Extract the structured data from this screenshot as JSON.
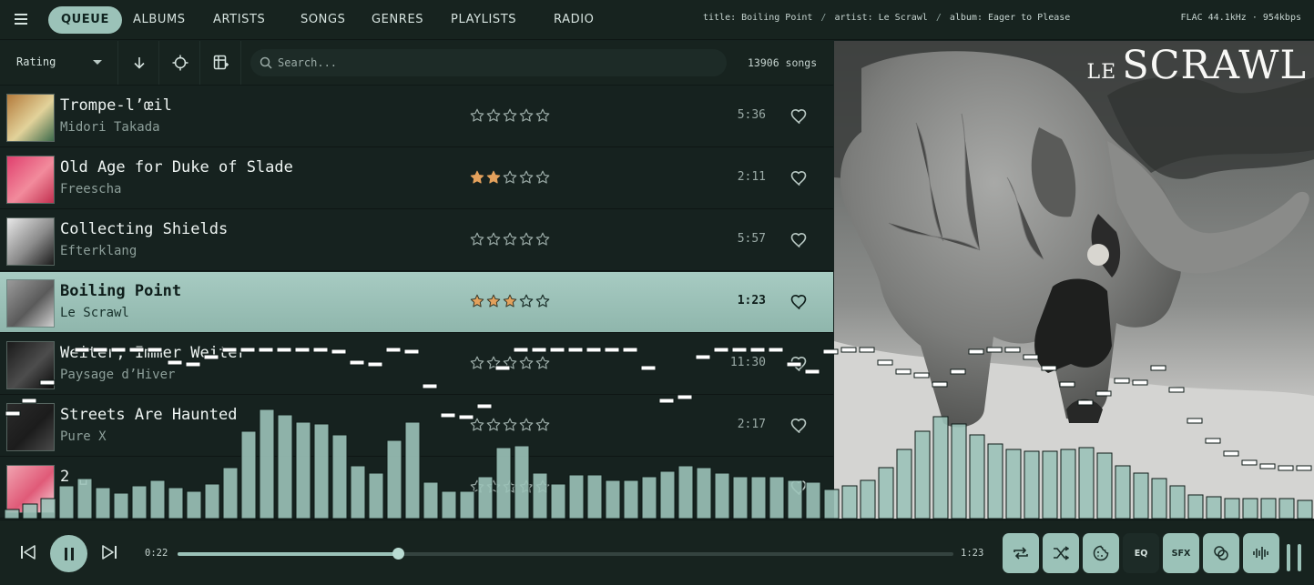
{
  "nav": {
    "tabs": [
      "QUEUE",
      "ALBUMS",
      "ARTISTS",
      "SONGS",
      "GENRES",
      "PLAYLISTS",
      "RADIO"
    ],
    "active_tab": "QUEUE"
  },
  "now_playing": {
    "title_text": "title: Boiling Point",
    "artist_text": "artist: Le Scrawl",
    "album_text": "album: Eager to Please",
    "separator": "/",
    "codec": "FLAC 44.1kHz · 954kbps"
  },
  "toolbar": {
    "sort_value": "Rating",
    "search_placeholder": "Search...",
    "song_count": "13906 songs"
  },
  "songs": [
    {
      "title": "Trompe-l’œil",
      "artist": "Midori Takada",
      "rating": 0,
      "duration": "5:36",
      "current": false,
      "thumb_colors": [
        "#b47b3c",
        "#e2d29a",
        "#3d6b4b"
      ]
    },
    {
      "title": "Old Age for Duke of Slade",
      "artist": "Freescha",
      "rating": 2,
      "duration": "2:11",
      "current": false,
      "thumb_colors": [
        "#e0406e",
        "#f28b9c",
        "#c23050"
      ]
    },
    {
      "title": "Collecting Shields",
      "artist": "Efterklang",
      "rating": 0,
      "duration": "5:57",
      "current": false,
      "thumb_colors": [
        "#e8e8e8",
        "#8b8b8b",
        "#1b1b1b"
      ]
    },
    {
      "title": "Boiling Point",
      "artist": "Le Scrawl",
      "rating": 3,
      "duration": "1:23",
      "current": true,
      "thumb_colors": [
        "#9a9a9a",
        "#5a5a5a",
        "#cfcfcf"
      ]
    },
    {
      "title": "Weiter, Immer Weiter",
      "artist": "Paysage d’Hiver",
      "rating": 0,
      "duration": "11:30",
      "current": false,
      "thumb_colors": [
        "#1a1a1a",
        "#4d4d4d",
        "#0b0b0b"
      ]
    },
    {
      "title": "Streets Are Haunted",
      "artist": "Pure X",
      "rating": 0,
      "duration": "2:17",
      "current": false,
      "thumb_colors": [
        "#2a2a2a",
        "#1c1c1c",
        "#4a4a4a"
      ]
    },
    {
      "title": "2 ␣",
      "artist": "",
      "rating": 0,
      "duration": "",
      "current": false,
      "thumb_colors": [
        "#f1a3b0",
        "#e05a78",
        "#f7d6da"
      ]
    }
  ],
  "album_art": {
    "brand_small": "LE",
    "brand_large": "SCRAWL"
  },
  "player": {
    "elapsed": "0:22",
    "total": "1:23",
    "progress": 0.2843,
    "buttons": {
      "eq": "EQ",
      "sfx": "SFX"
    },
    "volume_levels": [
      1.0,
      1.0
    ]
  },
  "icons": {
    "menu": "menu-icon",
    "sort_direction": "arrow-down-icon",
    "locate": "crosshair-icon",
    "columns": "columns-icon",
    "search": "search-icon",
    "star": "star-icon",
    "heart": "heart-icon",
    "prev": "skip-previous-icon",
    "play": "pause-icon",
    "next": "skip-next-icon",
    "repeat": "repeat-icon",
    "shuffle": "shuffle-icon",
    "dynamic": "cookie-icon",
    "radio": "link-circles-icon",
    "wave": "waveform-icon"
  },
  "colors": {
    "accent": "#9bc2b8",
    "star_filled": "#e3a15c",
    "background": "#16221f"
  }
}
